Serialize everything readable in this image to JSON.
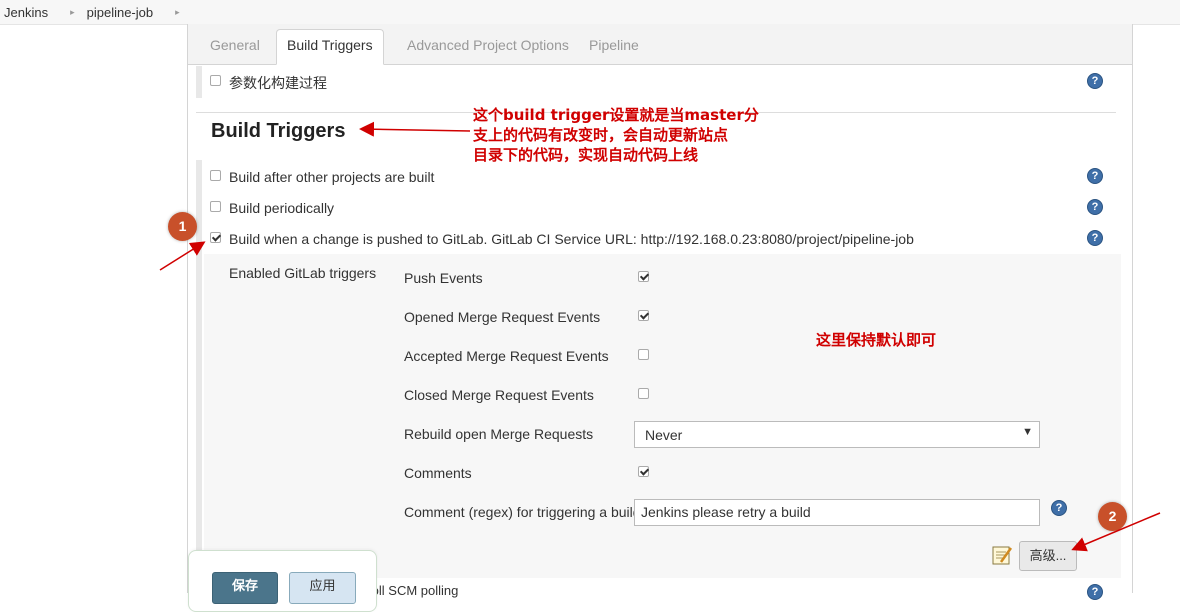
{
  "breadcrumb": {
    "items": [
      "Jenkins",
      "pipeline-job"
    ],
    "separator": "▸"
  },
  "tabs": [
    {
      "label": "General",
      "active": false
    },
    {
      "label": "Build Triggers",
      "active": true
    },
    {
      "label": "Advanced Project Options",
      "active": false
    },
    {
      "label": "Pipeline",
      "active": false
    }
  ],
  "general": {
    "param_build_label": "参数化构建过程",
    "param_build_checked": false
  },
  "build_triggers": {
    "title": "Build Triggers",
    "options": [
      {
        "label": "Build after other projects are built",
        "checked": false
      },
      {
        "label": "Build periodically",
        "checked": false
      },
      {
        "label": "Build when a change is pushed to GitLab. GitLab CI Service URL: http://192.168.0.23:8080/project/pipeline-job",
        "checked": true
      }
    ],
    "poll_scm_label": "Poll SCM polling"
  },
  "gitlab": {
    "enabled_label": "Enabled GitLab triggers",
    "events": [
      {
        "label": "Push Events",
        "checked": true
      },
      {
        "label": "Opened Merge Request Events",
        "checked": true
      },
      {
        "label": "Accepted Merge Request Events",
        "checked": false
      },
      {
        "label": "Closed Merge Request Events",
        "checked": false
      }
    ],
    "rebuild_label": "Rebuild open Merge Requests",
    "rebuild_value": "Never",
    "comments_label": "Comments",
    "comments_checked": true,
    "comment_regex_label": "Comment (regex) for triggering a build",
    "comment_regex_value": "Jenkins please retry a build",
    "advanced_button": "高级..."
  },
  "footer": {
    "save_label": "保存",
    "apply_label": "应用"
  },
  "annotations": {
    "top_note_lines": [
      "这个build trigger设置就是当master分",
      "支上的代码有改变时，会自动更新站点",
      "目录下的代码，实现自动代码上线"
    ],
    "mid_note": "这里保持默认即可",
    "badge1": "1",
    "badge2": "2"
  },
  "colors": {
    "annotation": "#d00000",
    "badge": "#c8502a",
    "save_button": "#4b758b",
    "help_icon": "#3f6fa8"
  }
}
